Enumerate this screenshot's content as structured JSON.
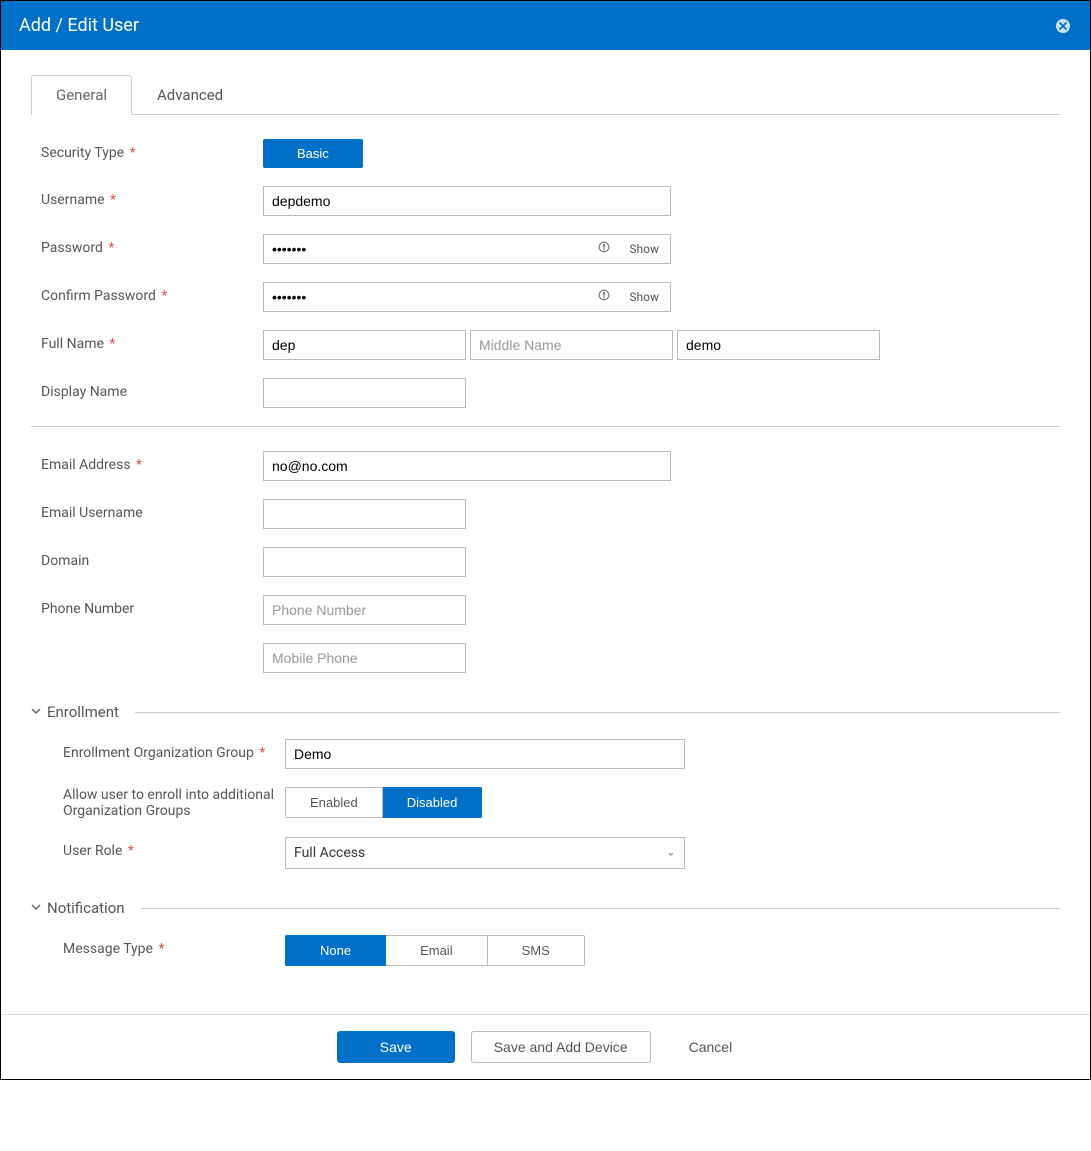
{
  "header": {
    "title": "Add / Edit User"
  },
  "tabs": {
    "general": "General",
    "advanced": "Advanced"
  },
  "labels": {
    "security_type": "Security Type",
    "username": "Username",
    "password": "Password",
    "confirm_password": "Confirm Password",
    "full_name": "Full Name",
    "display_name": "Display Name",
    "email_address": "Email Address",
    "email_username": "Email Username",
    "domain": "Domain",
    "phone_number": "Phone Number",
    "enrollment_org_group": "Enrollment Organization Group",
    "allow_enroll": "Allow user to enroll into additional Organization Groups",
    "user_role": "User Role",
    "message_type": "Message Type"
  },
  "sections": {
    "enrollment": "Enrollment",
    "notification": "Notification"
  },
  "values": {
    "security_type": "Basic",
    "username": "depdemo",
    "password": "•••••••",
    "confirm_password": "•••••••",
    "first_name": "dep",
    "middle_name": "",
    "last_name": "demo",
    "display_name": "",
    "email_address": "no@no.com",
    "email_username": "",
    "domain": "",
    "phone_number": "",
    "mobile_phone": "",
    "enrollment_org_group": "Demo",
    "user_role": "Full Access"
  },
  "placeholders": {
    "middle_name": "Middle Name",
    "phone_number": "Phone Number",
    "mobile_phone": "Mobile Phone"
  },
  "toggles": {
    "show": "Show",
    "enabled": "Enabled",
    "disabled": "Disabled",
    "none": "None",
    "email": "Email",
    "sms": "SMS"
  },
  "footer": {
    "save": "Save",
    "save_add_device": "Save and Add Device",
    "cancel": "Cancel"
  }
}
